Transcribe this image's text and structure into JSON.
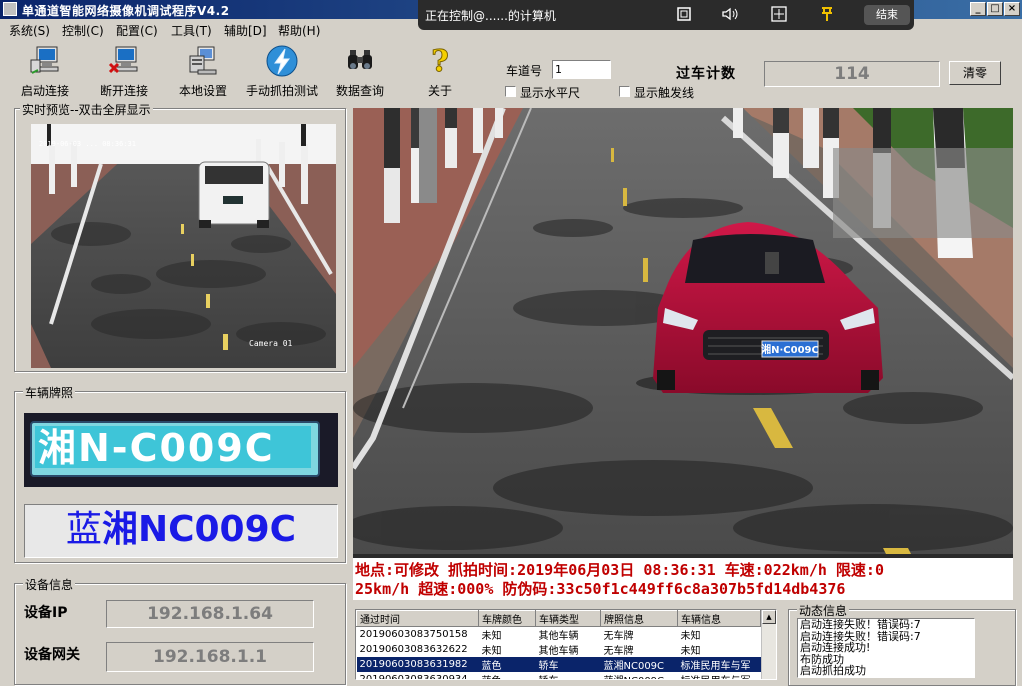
{
  "window": {
    "title": "单通道智能网络摄像机调试程序V4.2"
  },
  "menu": [
    "系统(S)",
    "控制(C)",
    "配置(C)",
    "工具(T)",
    "辅助[D]",
    "帮助(H)"
  ],
  "remote": {
    "title": "正在控制@......的计算机",
    "end_label": "结束"
  },
  "toolbar": {
    "connect": "启动连接",
    "disconnect": "断开连接",
    "local_settings": "本地设置",
    "manual_capture": "手动抓拍测试",
    "data_query": "数据查询",
    "about": "关于"
  },
  "controls": {
    "lane_label": "车道号",
    "lane_value": "1",
    "show_ruler": "显示水平尺",
    "show_trigger": "显示触发线",
    "count_label": "过车计数",
    "count_value": "114",
    "clear_label": "清零"
  },
  "preview": {
    "group_title": "实时预览--双击全屏显示",
    "osd_top": "2019-06-03  ...  08:36:31",
    "osd_camera": "Camera 01"
  },
  "plate_panel": {
    "group_title": "车辆牌照",
    "plate_image_text": "湘N-C009C",
    "recognized_color": "蓝",
    "recognized_plate": "湘NC009C"
  },
  "capture": {
    "car_plate": "湘N·C009C",
    "info_line1": "地点:可修改 抓拍时间:2019年06月03日 08:36:31 车速:022km/h 限速:0",
    "info_line2": "25km/h 超速:000% 防伪码:33c50f1c449ff6c8a307b5fd14db4376"
  },
  "device": {
    "group_title": "设备信息",
    "ip_label": "设备IP",
    "ip_value": "192.168.1.64",
    "gateway_label": "设备网关",
    "gateway_value": "192.168.1.1"
  },
  "records": {
    "headers": [
      "通过时间",
      "车牌颜色",
      "车辆类型",
      "牌照信息",
      "车辆信息"
    ],
    "rows": [
      [
        "20190603083750158",
        "未知",
        "其他车辆",
        "无车牌",
        "未知"
      ],
      [
        "20190603083632622",
        "未知",
        "其他车辆",
        "无车牌",
        "未知"
      ],
      [
        "20190603083631982",
        "蓝色",
        "轿车",
        "蓝湘NC009C",
        "标准民用车与军"
      ],
      [
        "20190603083630934",
        "蓝色",
        "轿车",
        "蓝湘NC009C",
        "标准民用车与军"
      ]
    ],
    "selected_index": 2
  },
  "log": {
    "group_title": "动态信息",
    "lines": [
      "启动连接失败！错误码:7",
      "启动连接失败！错误码:7",
      "启动连接成功!",
      "布防成功",
      "启动抓拍成功"
    ]
  },
  "colors": {
    "title_bar": "#0a246a",
    "overlay_red": "#c00000",
    "plate_blue_text": "#1a1ae6",
    "selection": "#0a246a"
  }
}
